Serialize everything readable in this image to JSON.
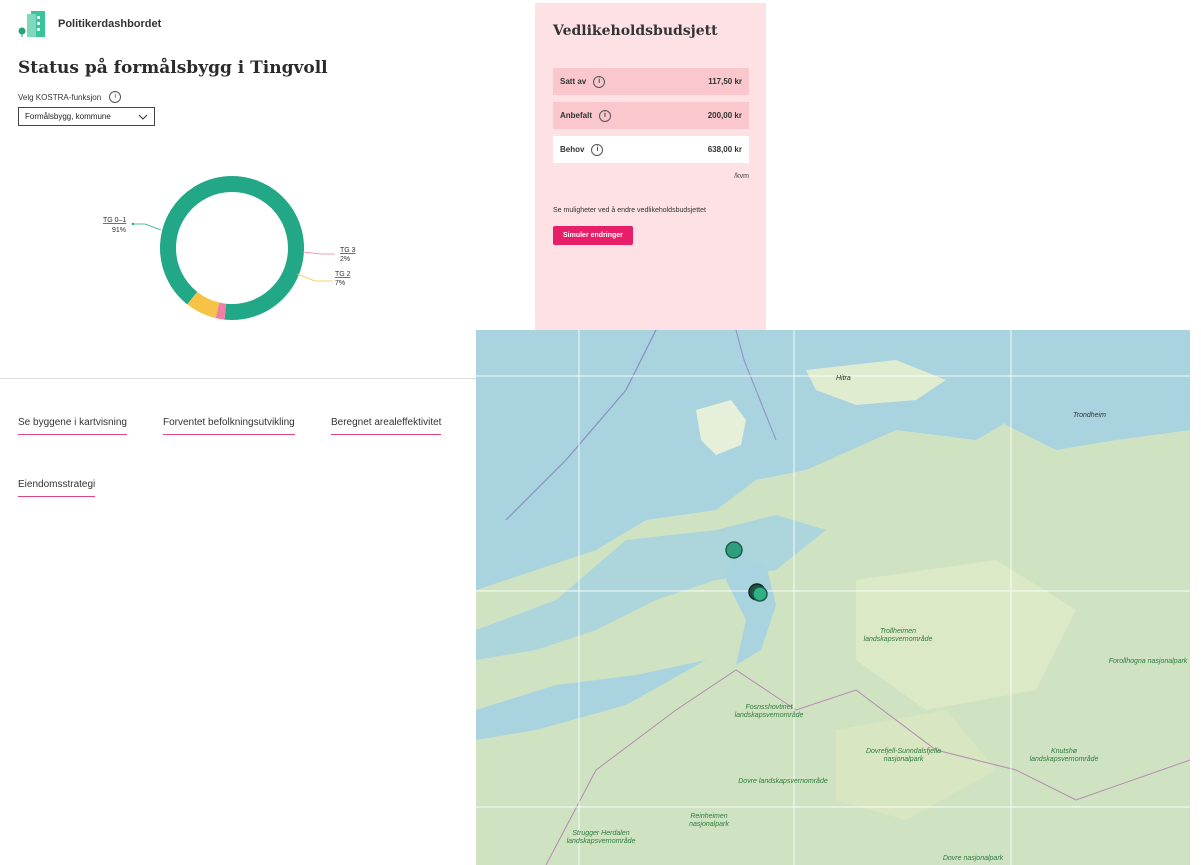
{
  "app": {
    "name": "Politikerdashbordet"
  },
  "page": {
    "title": "Status på formålsbygg i Tingvoll"
  },
  "kostra": {
    "label": "Velg KOSTRA-funksjon",
    "selected": "Formålsbygg, kommune"
  },
  "chart_data": {
    "type": "pie",
    "categories": [
      "TG 0–1",
      "TG 3",
      "TG 2"
    ],
    "values": [
      91,
      2,
      7
    ],
    "value_labels": [
      "91%",
      "2%",
      "7%"
    ],
    "colors": [
      "#22a887",
      "#f07fa3",
      "#f7c347"
    ]
  },
  "budget": {
    "title": "Vedlikeholdsbudsjett",
    "rows": [
      {
        "label": "Satt av",
        "value": "117,50 kr"
      },
      {
        "label": "Anbefalt",
        "value": "200,00 kr"
      },
      {
        "label": "Behov",
        "value": "638,00 kr"
      }
    ],
    "unit": "/kvm",
    "help_text": "Se muligheter ved å endre vedlikeholdsbudsjettet",
    "button": "Simuler endringer"
  },
  "links": [
    "Se byggene i kartvisning",
    "Forventet befolkningsutvikling",
    "Beregnet arealeffektivitet",
    "Eiendomsstrategi"
  ],
  "map": {
    "labels": [
      "Hitra",
      "Trondheim",
      "Trollheimen landskapsvernområde",
      "Forollhogna nasjonalpark",
      "Fosnsshovtinet landskapsvernområde",
      "Dovrefjell-Sunndalsfjella nasjonalpark",
      "Knutshø landskapsvernområde",
      "Dovre landskapsvernområde",
      "Reinheimen nasjonalpark",
      "Strugger Herdalen landskapsvernområde",
      "Dovre nasjonalpark"
    ]
  },
  "colors": {
    "accent": "#e81f68",
    "panel_bg": "#fde1e4",
    "tg01": "#22a887"
  }
}
